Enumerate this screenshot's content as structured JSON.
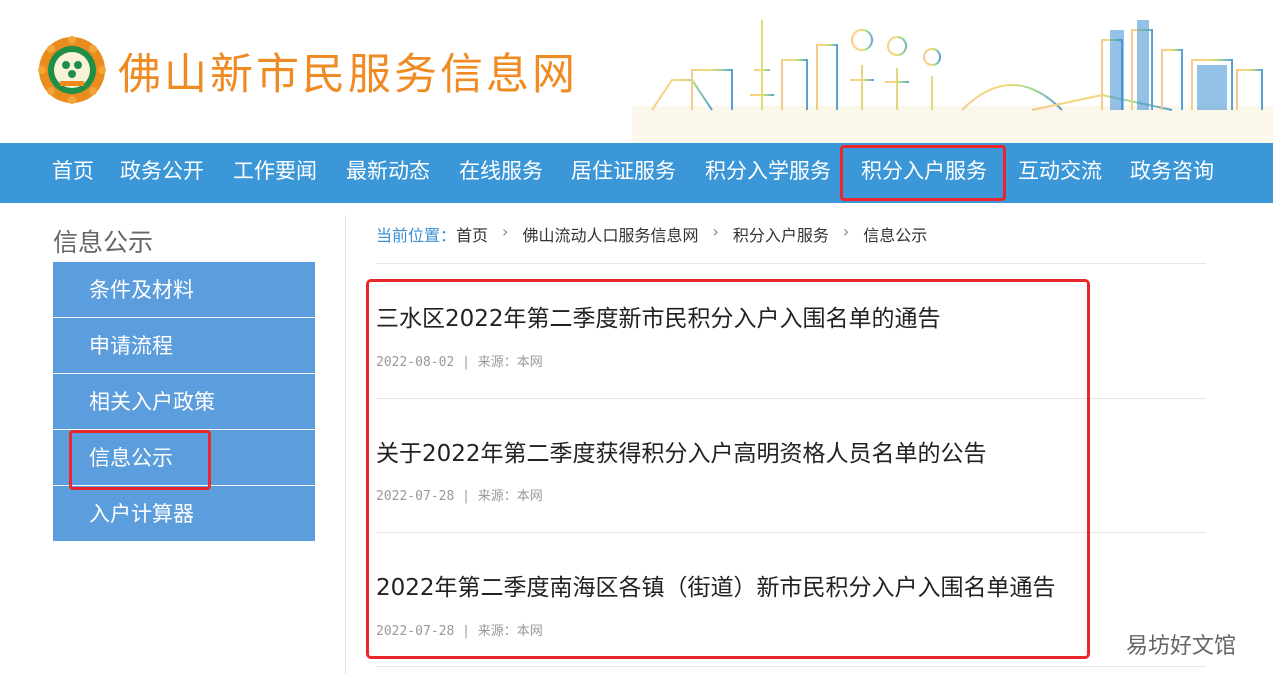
{
  "header": {
    "site_title": "佛山新市民服务信息网",
    "logo_name": "foshan-emblem"
  },
  "nav": {
    "items": [
      "首页",
      "政务公开",
      "工作要闻",
      "最新动态",
      "在线服务",
      "居住证服务",
      "积分入学服务",
      "积分入户服务",
      "互动交流",
      "政务咨询"
    ],
    "active_index": 7
  },
  "sidebar": {
    "title": "信息公示",
    "items": [
      "条件及材料",
      "申请流程",
      "相关入户政策",
      "信息公示",
      "入户计算器"
    ],
    "active_index": 3
  },
  "breadcrumb": {
    "label": "当前位置：",
    "items": [
      "首页",
      "佛山流动人口服务信息网",
      "积分入户服务",
      "信息公示"
    ],
    "separator": "›"
  },
  "articles": [
    {
      "title": "三水区2022年第二季度新市民积分入户入围名单的通告",
      "date": "2022-08-02",
      "source": "来源：本网"
    },
    {
      "title": "关于2022年第二季度获得积分入户高明资格人员名单的公告",
      "date": "2022-07-28",
      "source": "来源：本网"
    },
    {
      "title": "2022年第二季度南海区各镇（街道）新市民积分入户入围名单通告",
      "date": "2022-07-28",
      "source": "来源：本网"
    }
  ],
  "meta_separator": "|",
  "watermark": "易坊好文馆",
  "colors": {
    "nav_bg": "#3b97d7",
    "sidebar_bg": "#5b9ddd",
    "title_orange": "#f08a22",
    "highlight_red": "#e8262b"
  }
}
